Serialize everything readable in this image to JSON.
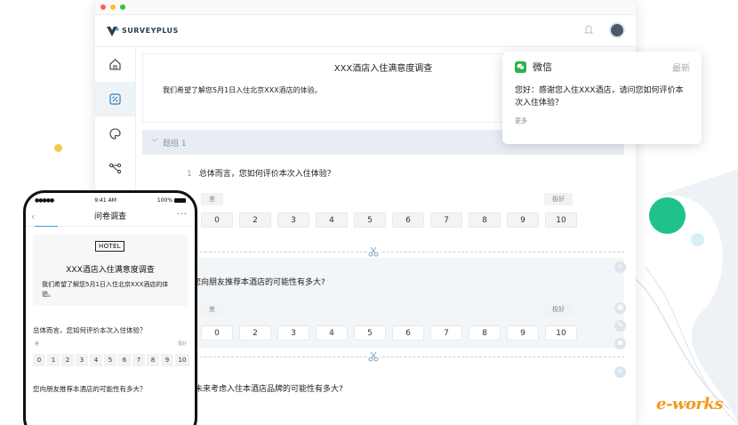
{
  "window": {
    "logo_text": "SURVEYPLUS"
  },
  "sidebar": {
    "items": [
      {
        "icon": "home-icon",
        "active": false
      },
      {
        "icon": "survey-icon",
        "active": true
      },
      {
        "icon": "palette-icon",
        "active": false
      },
      {
        "icon": "share-icon",
        "active": false
      }
    ]
  },
  "survey": {
    "title": "XXX酒店入住满意度调查",
    "description": "我们希望了解您5月1日入住北京XXX酒店的体验。",
    "group_label": "题组 1",
    "questions": [
      {
        "number": "1",
        "text": "总体而言，您如何评价本次入住体验？",
        "low_label": "差",
        "high_label": "极好",
        "scale": [
          "0",
          "2",
          "3",
          "4",
          "5",
          "6",
          "7",
          "8",
          "9",
          "10"
        ]
      },
      {
        "text": "您向朋友推荐本酒店的可能性有多大?",
        "low_label": "差",
        "high_label": "极好",
        "scale": [
          "0",
          "2",
          "3",
          "4",
          "5",
          "6",
          "7",
          "8",
          "9",
          "10"
        ]
      },
      {
        "text": "您未来考虑入住本酒店品牌的可能性有多大?"
      }
    ]
  },
  "wechat": {
    "app_name": "微信",
    "latest_label": "最新",
    "message": "您好：感谢您入住XXX酒店，请问您如何评价本次入住体验？",
    "more_label": "更多"
  },
  "phone": {
    "time": "9:41 AM",
    "signal": "●●●●●",
    "battery": "100%",
    "nav_title": "问卷调查",
    "hotel_badge": "HOTEL",
    "survey_title": "XXX酒店入住满意度调查",
    "survey_desc": "我们希望了解您5月1日入住北京XXX酒店的体验。",
    "q1": "总体而言，您如何评价本次入住体验？",
    "low_label": "差",
    "high_label": "极好",
    "scale": [
      "0",
      "1",
      "2",
      "3",
      "4",
      "5",
      "6",
      "7",
      "8",
      "9",
      "10"
    ],
    "q2": "您向朋友推荐本酒店的可能性有多大？"
  },
  "watermark": "e-works",
  "colors": {
    "accent": "#3aa0d8",
    "wechat_green": "#2bb24c",
    "deco_green": "#1fc28b",
    "deco_yellow": "#f7c948"
  }
}
